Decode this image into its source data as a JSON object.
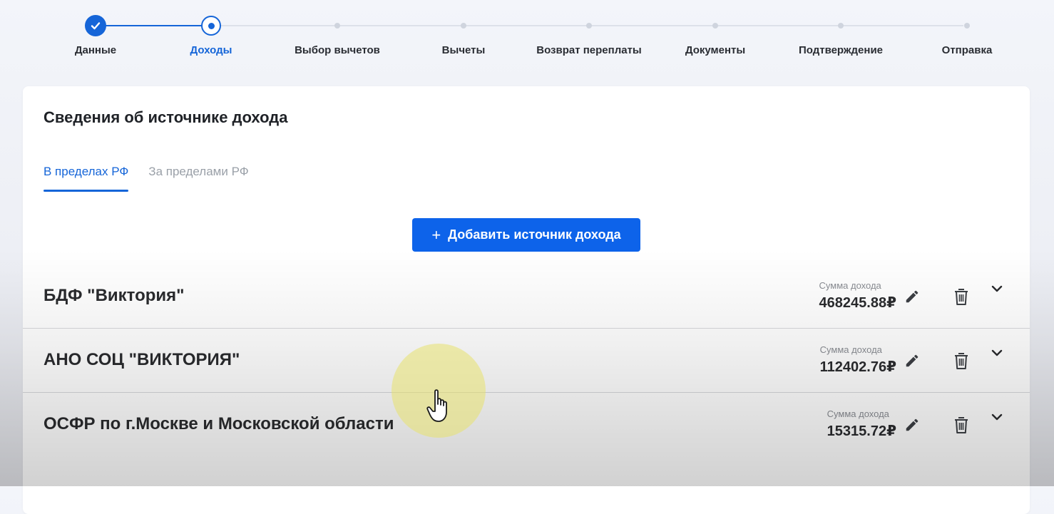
{
  "stepper": {
    "steps": [
      {
        "label": "Данные",
        "state": "done"
      },
      {
        "label": "Доходы",
        "state": "current"
      },
      {
        "label": "Выбор вычетов",
        "state": "todo"
      },
      {
        "label": "Вычеты",
        "state": "todo"
      },
      {
        "label": "Возврат переплаты",
        "state": "todo"
      },
      {
        "label": "Документы",
        "state": "todo"
      },
      {
        "label": "Подтверждение",
        "state": "todo"
      },
      {
        "label": "Отправка",
        "state": "todo"
      }
    ]
  },
  "card": {
    "title": "Сведения об источнике дохода",
    "tabs": [
      {
        "label": "В пределах РФ",
        "active": true
      },
      {
        "label": "За пределами РФ",
        "active": false
      }
    ],
    "add_button": {
      "icon": "plus-icon",
      "label": "Добавить источник дохода"
    }
  },
  "income_sources": [
    {
      "name": "БДФ \"Виктория\"",
      "amount_label": "Сумма дохода",
      "amount": "468245.88₽"
    },
    {
      "name": "АНО СОЦ \"ВИКТОРИЯ\"",
      "amount_label": "Сумма дохода",
      "amount": "112402.76₽"
    },
    {
      "name": "ОСФР по г.Москве и Московской области",
      "amount_label": "Сумма дохода",
      "amount": "15315.72₽"
    }
  ],
  "icons": {
    "edit": "pencil-icon",
    "delete": "trash-icon",
    "expand": "chevron-down-icon"
  },
  "colors": {
    "accent": "#1565d8",
    "button": "#0d63ea"
  }
}
